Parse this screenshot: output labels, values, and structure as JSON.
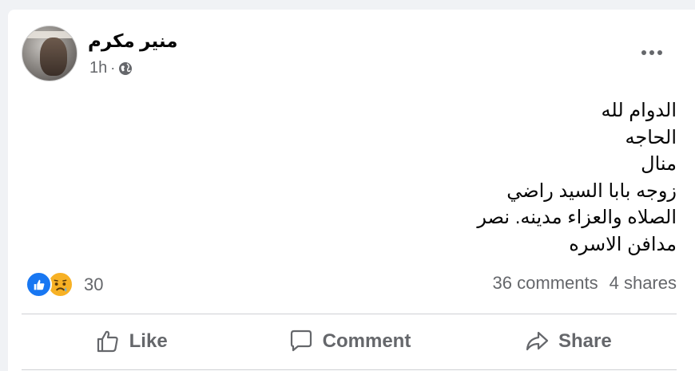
{
  "post": {
    "author": "منير مكرم",
    "time": "1h",
    "separator": "·",
    "privacy_icon": "globe-icon",
    "more_icon": "more-options-icon",
    "text_lines": [
      "الدوام لله",
      "الحاجه",
      "منال",
      "زوجه بابا السيد راضي",
      "الصلاه والعزاء مدينه. نصر",
      "مدافن الاسره"
    ]
  },
  "engagement": {
    "reactions": [
      "like",
      "sad"
    ],
    "reaction_count": "30",
    "comments": "36 comments",
    "shares": "4 shares"
  },
  "actions": {
    "like": "Like",
    "comment": "Comment",
    "share": "Share"
  },
  "colors": {
    "brand_blue": "#1877f2",
    "sad_yellow": "#f7b125",
    "secondary_text": "#65676b",
    "primary_text": "#050505",
    "background": "#f0f2f5"
  }
}
